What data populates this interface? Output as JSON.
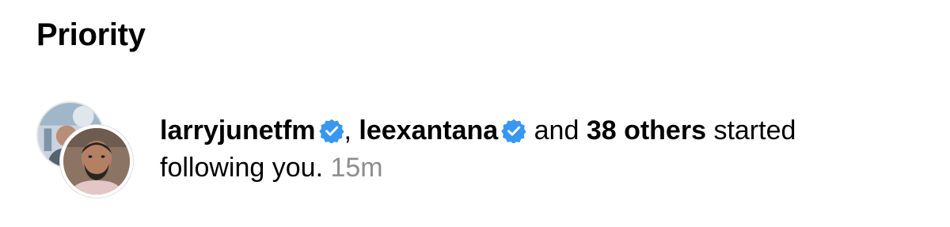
{
  "section": {
    "title": "Priority"
  },
  "notification": {
    "users": [
      {
        "username": "larryjunetfm",
        "verified": true
      },
      {
        "username": "leexantana",
        "verified": true
      }
    ],
    "separator": ",",
    "connector": "and",
    "others": "38 others",
    "action_line1": "started",
    "action_line2": "following you.",
    "timestamp": "15m"
  },
  "icons": {
    "verified": "verified-badge-icon",
    "avatar": "avatar-photo"
  },
  "colors": {
    "verified": "#3897f0",
    "timestamp": "#8e8e8e",
    "text": "#000000",
    "background": "#ffffff"
  }
}
